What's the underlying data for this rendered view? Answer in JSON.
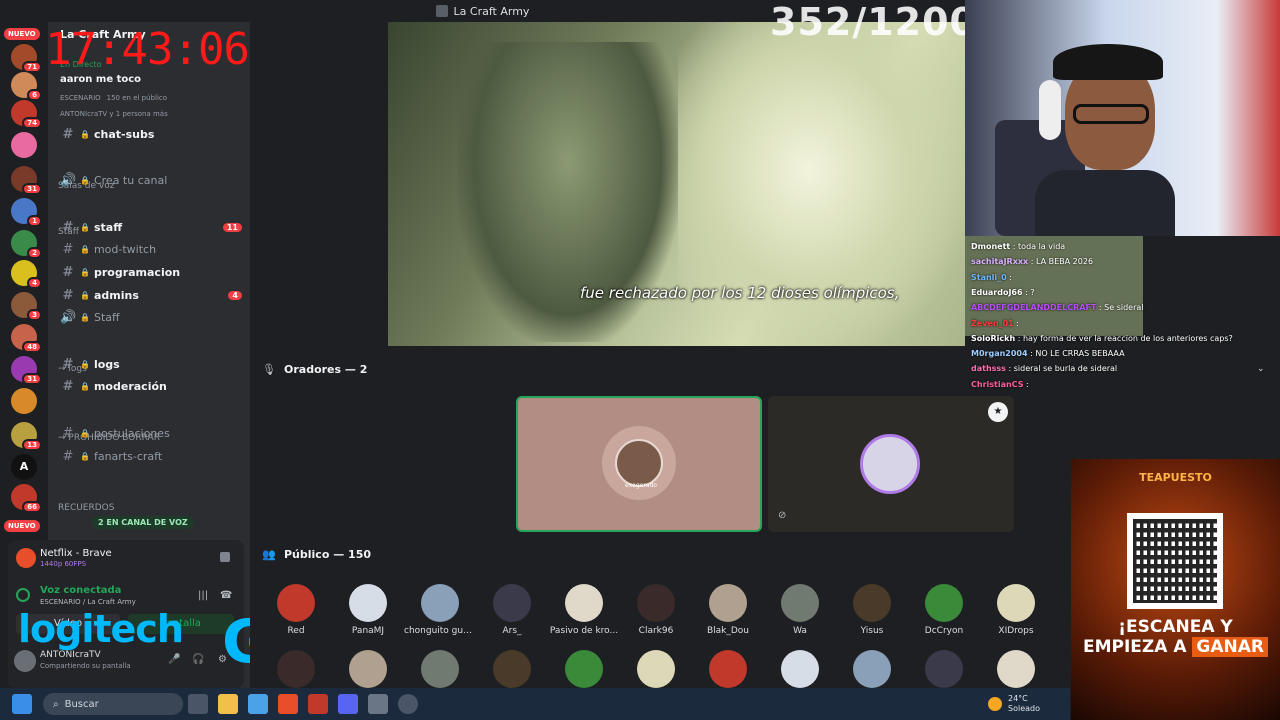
{
  "window": {
    "title": "La Craft Army"
  },
  "overlay": {
    "clock": "17:43:06",
    "counter": "352/1200"
  },
  "server": {
    "name": "La Craft Army",
    "live_label": "En Directo",
    "stream_title": "aaron me toco",
    "stage_label": "ESCENARIO",
    "audience_count": "150 en el público",
    "viewers": "ANTONIcraTV y 1 persona más"
  },
  "guild_badges": [
    "NUEVO",
    "71",
    "6",
    "74",
    "31",
    "1",
    "2",
    "4",
    "3",
    "48",
    "31",
    "13",
    "66",
    "NUEVO"
  ],
  "channels": [
    {
      "label": "chat-subs",
      "bold": true,
      "prefix": "💚 |",
      "count": ""
    },
    {
      "category": "Salas de voz"
    },
    {
      "label": "Crea tu canal",
      "bold": false,
      "voice": true,
      "count": ""
    },
    {
      "category": "Staff"
    },
    {
      "label": "staff",
      "bold": true,
      "count": "11"
    },
    {
      "label": "mod-twitch",
      "bold": false,
      "count": ""
    },
    {
      "label": "programacion",
      "bold": true,
      "count": ""
    },
    {
      "label": "admins",
      "bold": true,
      "count": "4"
    },
    {
      "label": "Staff",
      "bold": false,
      "voice": true,
      "count": ""
    },
    {
      "category": "→ logs"
    },
    {
      "label": "logs",
      "bold": true,
      "count": ""
    },
    {
      "label": "moderación",
      "bold": true,
      "count": ""
    },
    {
      "category": "→ PROHIBIDO BORRAR"
    },
    {
      "label": "postulaciones",
      "bold": false,
      "count": ""
    },
    {
      "label": "fanarts-craft",
      "bold": false,
      "count": ""
    },
    {
      "category": "RECUERDOS"
    }
  ],
  "voice_pill": "2 EN CANAL DE VOZ",
  "activity": {
    "app": "Netflix - Brave",
    "quality": "1440p 60FPS"
  },
  "voice_panel": {
    "status": "Voz conectada",
    "location": "ESCENARIO / La Craft Army",
    "video_btn": "Vídeo",
    "screen_btn": "Pantalla",
    "user": "ANTONIcraTV",
    "sharing": "Compartiendo su pantalla"
  },
  "video": {
    "subtitle": "fue rechazado por los 12 dioses olímpicos,"
  },
  "stage": {
    "speakers_header": "Oradores — 2",
    "audience_header": "Público — 150",
    "speaker_name": "exagerado",
    "audience": [
      "Red",
      "PanaMJ",
      "chonguito gue...",
      "Ars_",
      "Pasivo de kro...",
      "Clark96",
      "Blak_Dou",
      "Wa",
      "Yisus",
      "DcCryon",
      "XIDrops"
    ]
  },
  "chat": [
    {
      "user": "Dmonett",
      "msg": "toda la vida",
      "color": "#ffffff"
    },
    {
      "user": "sachitaJRxxx",
      "msg": "LA BEBA 2026",
      "color": "#d9b0ff"
    },
    {
      "user": "Stanli_0",
      "msg": "",
      "color": "#6fb6ff"
    },
    {
      "user": "EduardoJ66",
      "msg": "?",
      "color": "#ffffff"
    },
    {
      "user": "ABCDEFGDELANDDELCRAFT",
      "msg": "Se sideral",
      "color": "#b84dff"
    },
    {
      "user": "Zeven_01",
      "msg": "",
      "color": "#ff3b3b"
    },
    {
      "user": "SoloRickh",
      "msg": "hay forma de ver la reaccion de los anteriores caps?",
      "color": "#ffffff"
    },
    {
      "user": "M0rgan2004",
      "msg": "NO LE CRRAS BEBAAA",
      "color": "#9ecbff"
    },
    {
      "user": "dathsss",
      "msg": "sideral se burla de sideral",
      "color": "#ff6fb1"
    },
    {
      "user": "ChristianCS",
      "msg": "",
      "color": "#ff5fa0"
    }
  ],
  "ad": {
    "brand": "TEAPUESTO",
    "line1": "¡ESCANEA Y",
    "line2a": "EMPIEZA A",
    "line2b": "GANAR"
  },
  "logo": {
    "text": "logitech",
    "mark": "G"
  },
  "taskbar": {
    "search": "Buscar",
    "temp": "24°C",
    "weather": "Soleado"
  },
  "colors": {
    "accent": "#5865f2",
    "danger": "#f23f43",
    "online": "#23a55a",
    "clock": "#ff1a1a",
    "logi": "#00b8fc"
  }
}
